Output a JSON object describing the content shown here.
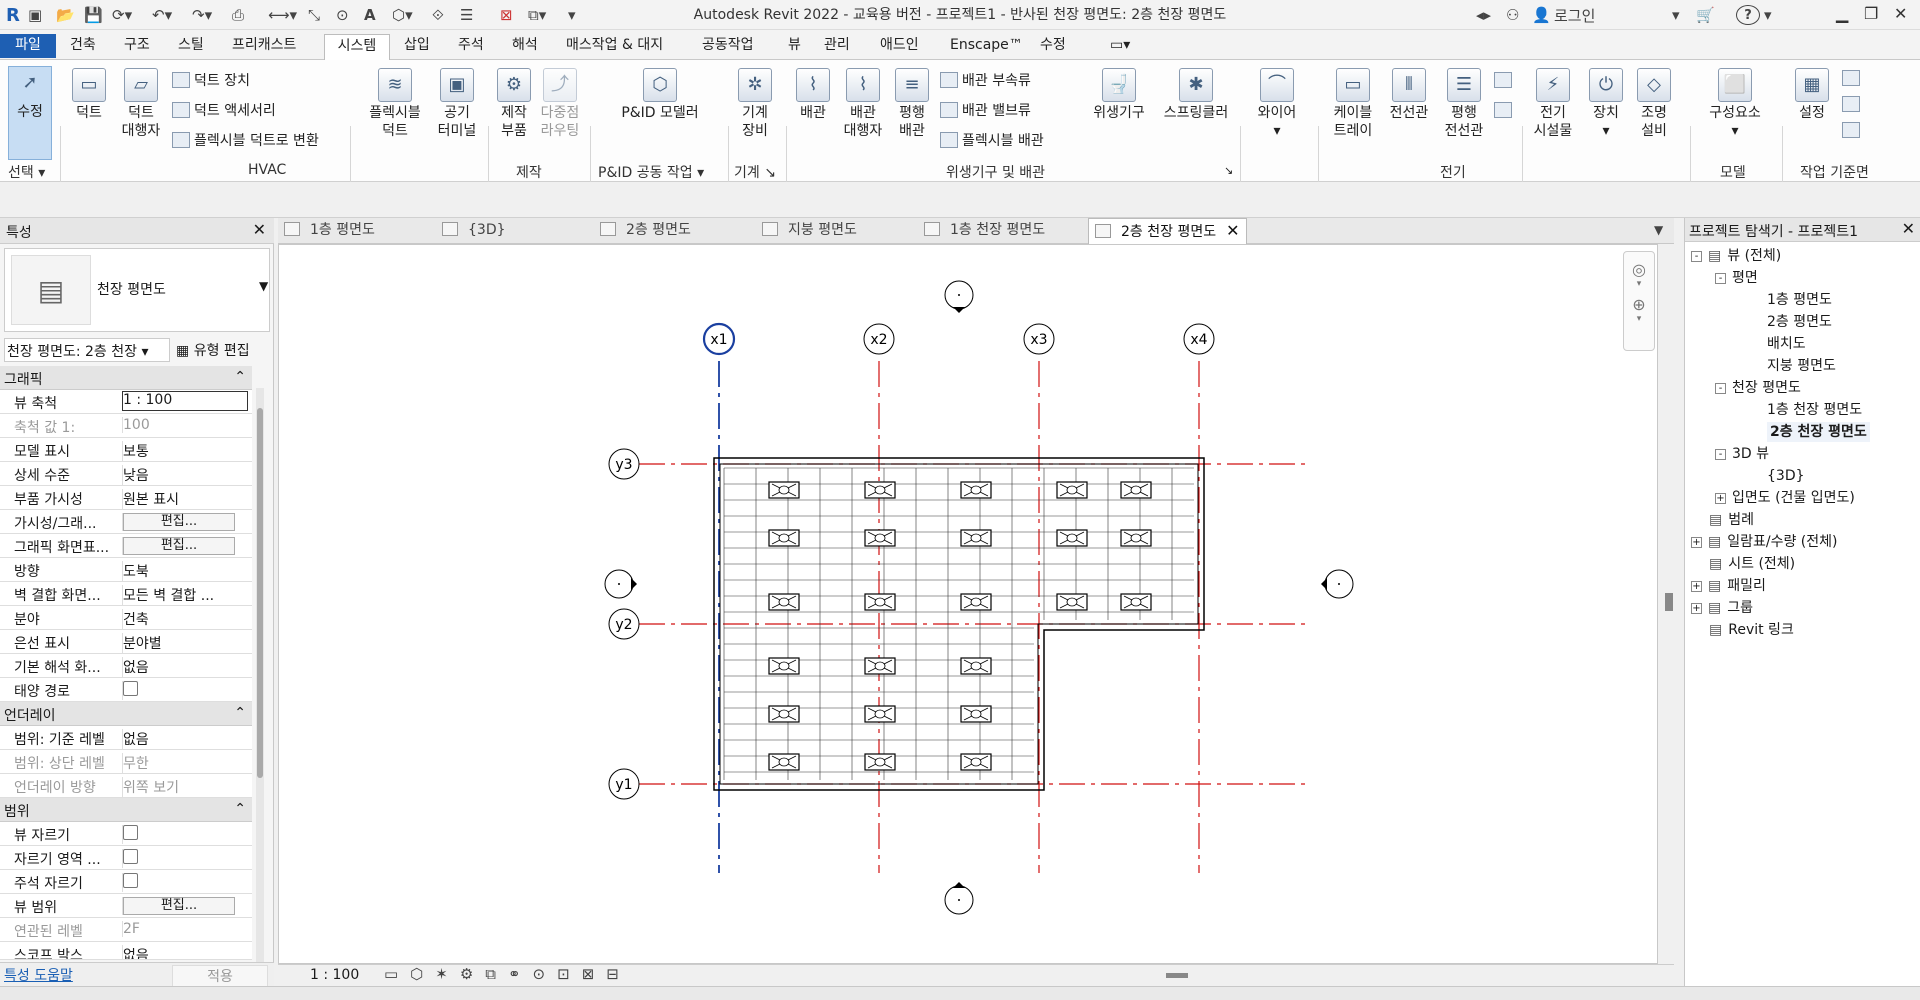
{
  "app": {
    "title": "Autodesk Revit 2022 - 교육용 버전 - 프로젝트1 - 반사된 천장 평면도: 2층 천장 평면도",
    "login": "로그인",
    "help": "?"
  },
  "ribbon_tabs": [
    "파일",
    "건축",
    "구조",
    "스틸",
    "프리캐스트",
    "시스템",
    "삽입",
    "주석",
    "해석",
    "매스작업 & 대지",
    "공동작업",
    "뷰",
    "관리",
    "애드인",
    "Enscape™",
    "수정"
  ],
  "ribbon": {
    "modify": "수정",
    "select": "선택",
    "duct": "덕트",
    "duct_placeholder": "덕트\n대행자",
    "duct_fitting": "덕트 장치",
    "duct_accessory": "덕트 액세서리",
    "convert_flex": "플렉시블 덕트로 변환",
    "flex_duct": "플렉시블\n덕트",
    "air_terminal": "공기\n터미널",
    "hvac": "HVAC",
    "fab_part": "제작\n부품",
    "multipoint": "다중점\n라우팅",
    "fabrication": "제작",
    "pid_modeler": "P&ID 모델러",
    "pid_collab": "P&ID 공동 작업",
    "mech_equip": "기계\n장비",
    "mechanical": "기계",
    "pipe": "배관",
    "pipe_placeholder": "배관\n대행자",
    "parallel_pipes": "평행\n배관",
    "pipe_fitting": "배관 부속류",
    "pipe_accessory": "배관 밸브류",
    "flex_pipe": "플렉시블 배관",
    "plumbing_fixture": "위생기구",
    "sprinkler": "스프링클러",
    "plumbing": "위생기구 및 배관",
    "wire": "와이어",
    "cable_tray": "케이블\n트레이",
    "conduit": "전선관",
    "parallel_conduits": "평행\n전선관",
    "elec_equip": "전기\n시설물",
    "device": "장치",
    "lighting": "조명\n설비",
    "electrical": "전기",
    "component": "구성요소",
    "model": "모델",
    "set": "설정",
    "workplane": "작업 기준면"
  },
  "properties": {
    "panel_title": "특성",
    "type_name": "천장 평면도",
    "instance_selector": "천장 평면도: 2층 천장",
    "edit_type": "유형 편집",
    "sections": {
      "graphics": "그래픽",
      "underlay": "언더레이",
      "extents": "범위"
    },
    "rows": [
      {
        "k": "뷰 축척",
        "v": "1 : 100"
      },
      {
        "k": "축척 값    1:",
        "v": "100"
      },
      {
        "k": "모델 표시",
        "v": "보통"
      },
      {
        "k": "상세 수준",
        "v": "낮음"
      },
      {
        "k": "부품 가시성",
        "v": "원본 표시"
      },
      {
        "k": "가시성/그래...",
        "v": "편집..."
      },
      {
        "k": "그래픽 화면표...",
        "v": "편집..."
      },
      {
        "k": "방향",
        "v": "도북"
      },
      {
        "k": "벽 결합 화면...",
        "v": "모든 벽 결합 ..."
      },
      {
        "k": "분야",
        "v": "건축"
      },
      {
        "k": "은선 표시",
        "v": "분야별"
      },
      {
        "k": "기본 해석 화...",
        "v": "없음"
      },
      {
        "k": "태양 경로",
        "v": ""
      },
      {
        "k": "범위: 기준 레벨",
        "v": "없음"
      },
      {
        "k": "범위: 상단 레벨",
        "v": "무한"
      },
      {
        "k": "언더레이 방향",
        "v": "위쪽 보기"
      },
      {
        "k": "뷰 자르기",
        "v": ""
      },
      {
        "k": "자르기 영역 ...",
        "v": ""
      },
      {
        "k": "주석 자르기",
        "v": ""
      },
      {
        "k": "뷰 범위",
        "v": "편집..."
      },
      {
        "k": "연관된 레벨",
        "v": "2F"
      },
      {
        "k": "스코프 박스",
        "v": "없음"
      }
    ],
    "help_link": "특성 도움말",
    "apply": "적용"
  },
  "view_tabs": [
    "1층 평면도",
    "{3D}",
    "2층 평면도",
    "지붕 평면도",
    "1층 천장 평면도",
    "2층 천장 평면도"
  ],
  "canvas": {
    "grids_x": [
      "x1",
      "x2",
      "x3",
      "x4"
    ],
    "grids_y": [
      "y3",
      "y2",
      "y1"
    ]
  },
  "view_control": {
    "scale": "1 : 100"
  },
  "browser": {
    "title": "프로젝트 탐색기 - 프로젝트1",
    "nodes": [
      {
        "t": "뷰 (전체)",
        "lvl": 0,
        "tog": "-"
      },
      {
        "t": "평면",
        "lvl": 1,
        "tog": "-"
      },
      {
        "t": "1층 평면도",
        "lvl": 2,
        "tog": ""
      },
      {
        "t": "2층 평면도",
        "lvl": 2,
        "tog": ""
      },
      {
        "t": "배치도",
        "lvl": 2,
        "tog": ""
      },
      {
        "t": "지붕 평면도",
        "lvl": 2,
        "tog": ""
      },
      {
        "t": "천장 평면도",
        "lvl": 1,
        "tog": "-"
      },
      {
        "t": "1층 천장 평면도",
        "lvl": 2,
        "tog": ""
      },
      {
        "t": "2층 천장 평면도",
        "lvl": 2,
        "tog": "",
        "bold": true
      },
      {
        "t": "3D 뷰",
        "lvl": 1,
        "tog": "-"
      },
      {
        "t": "{3D}",
        "lvl": 2,
        "tog": ""
      },
      {
        "t": "입면도 (건물 입면도)",
        "lvl": 1,
        "tog": "+"
      },
      {
        "t": "범례",
        "lvl": 0,
        "tog": ""
      },
      {
        "t": "일람표/수량 (전체)",
        "lvl": 0,
        "tog": "+"
      },
      {
        "t": "시트 (전체)",
        "lvl": 0,
        "tog": ""
      },
      {
        "t": "패밀리",
        "lvl": 0,
        "tog": "+"
      },
      {
        "t": "그룹",
        "lvl": 0,
        "tog": "+"
      },
      {
        "t": "Revit 링크",
        "lvl": 0,
        "tog": ""
      }
    ]
  },
  "colors": {
    "file_tab": "#1e5fb3",
    "grid_selected": "#1a3fa0",
    "grid_red": "#d01010"
  }
}
